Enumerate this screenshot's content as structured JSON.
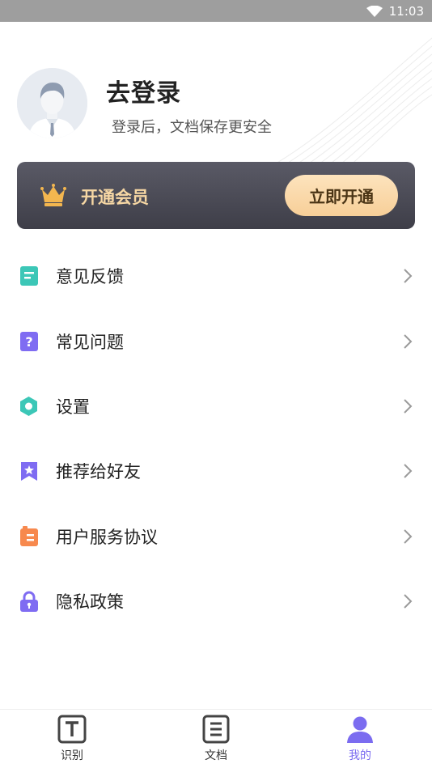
{
  "status_bar": {
    "time": "11:03",
    "icons": [
      "wifi-icon",
      "battery-icon"
    ]
  },
  "profile": {
    "title": "去登录",
    "subtitle": "登录后，文档保存更安全",
    "avatar_icon": "user-avatar-icon"
  },
  "vip": {
    "label": "开通会员",
    "button_label": "立即开通",
    "icon": "crown-icon",
    "colors": {
      "card": "#4a4a55",
      "label": "#f6d7a4",
      "button": "#fbd8a9"
    }
  },
  "menu": {
    "items": [
      {
        "label": "意见反馈",
        "icon": "feedback-icon",
        "color": "#3cc7b7"
      },
      {
        "label": "常见问题",
        "icon": "question-icon",
        "color": "#7f6cf2"
      },
      {
        "label": "设置",
        "icon": "settings-hexagon-icon",
        "color": "#3cc7b7"
      },
      {
        "label": "推荐给好友",
        "icon": "star-bookmark-icon",
        "color": "#7f6cf2"
      },
      {
        "label": "用户服务协议",
        "icon": "document-icon",
        "color": "#f7894e"
      },
      {
        "label": "隐私政策",
        "icon": "lock-icon",
        "color": "#7f6cf2"
      }
    ]
  },
  "bottom_nav": {
    "tabs": [
      {
        "label": "识别",
        "icon": "text-recognize-icon",
        "active": false
      },
      {
        "label": "文档",
        "icon": "document-list-icon",
        "active": false
      },
      {
        "label": "我的",
        "icon": "user-icon",
        "active": true
      }
    ],
    "active_color": "#7b6cf0"
  }
}
